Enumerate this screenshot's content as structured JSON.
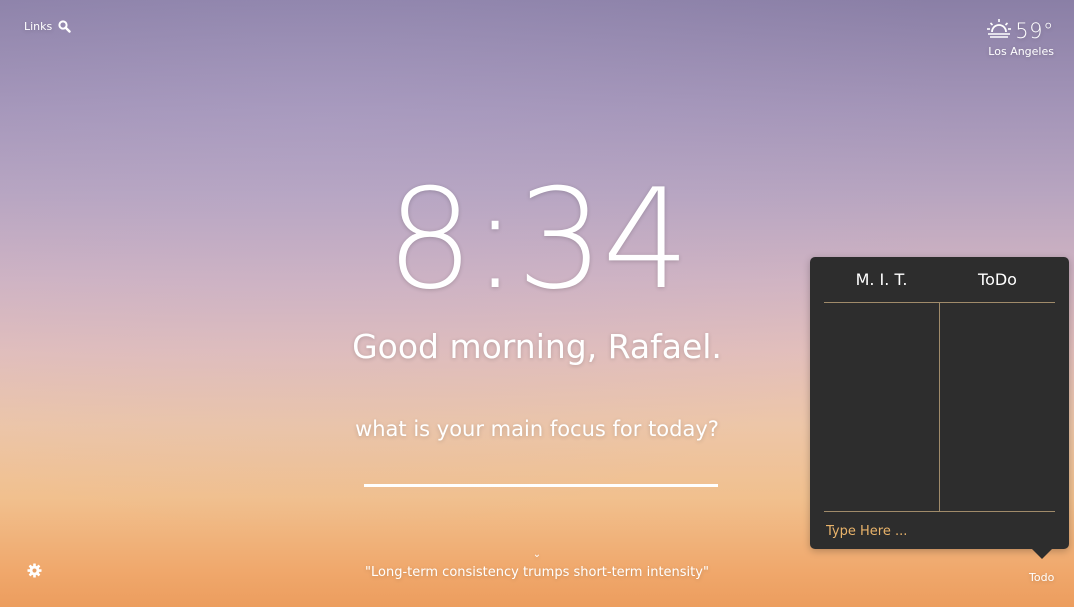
{
  "top_left": {
    "links_label": "Links",
    "search_icon": "search-icon"
  },
  "weather": {
    "icon": "sunrise-icon",
    "temperature": "59°",
    "location": "Los Angeles"
  },
  "clock": {
    "time": "8:34"
  },
  "greeting": "Good morning, Rafael.",
  "focus": {
    "question": "what is your main focus for today?",
    "value": ""
  },
  "quote": {
    "text": "\"Long-term consistency trumps short-term intensity\"",
    "chevron": "⌄"
  },
  "settings": {
    "icon": "gear-icon"
  },
  "todo": {
    "column_mit": "M. I. T.",
    "column_todo": "ToDo",
    "mit_items": [],
    "todo_items": [],
    "input_placeholder": "Type Here ...",
    "toggle_label": "Todo"
  },
  "colors": {
    "panel_bg": "#2d2d2d",
    "divider": "#a08b6a",
    "accent_text": "#e9b36a"
  }
}
